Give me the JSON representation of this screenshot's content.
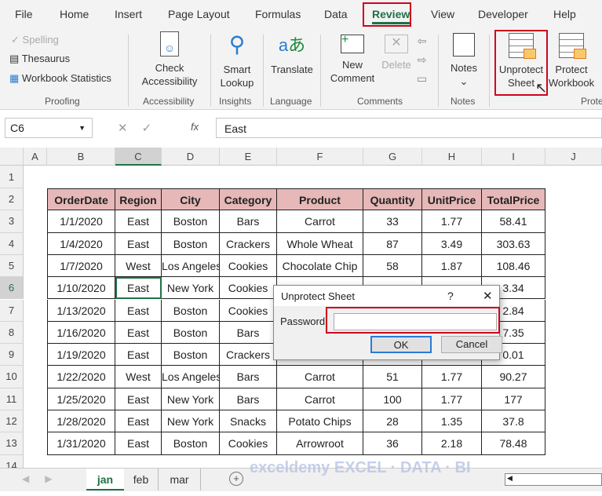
{
  "menu_tabs": [
    "File",
    "Home",
    "Insert",
    "Page Layout",
    "Formulas",
    "Data",
    "Review",
    "View",
    "Developer",
    "Help"
  ],
  "active_tab": "Review",
  "ribbon": {
    "spelling": "Spelling",
    "thesaurus": "Thesaurus",
    "workbook_statistics": "Workbook Statistics",
    "check_accessibility": [
      "Check",
      "Accessibility"
    ],
    "smart_lookup": [
      "Smart",
      "Lookup"
    ],
    "translate": "Translate",
    "new_comment": [
      "New",
      "Comment"
    ],
    "delete": "Delete",
    "notes": "Notes",
    "unprotect_sheet": [
      "Unprotect",
      "Sheet"
    ],
    "protect_workbook": [
      "Protect",
      "Workbook"
    ],
    "groups": [
      "Proofing",
      "Accessibility",
      "Insights",
      "Language",
      "Comments",
      "Notes",
      "Prote"
    ]
  },
  "formula_bar": {
    "name_box": "C6",
    "fx": "fx",
    "value": "East"
  },
  "columns": [
    "A",
    "B",
    "C",
    "D",
    "E",
    "F",
    "G",
    "H",
    "I",
    "J"
  ],
  "rows": [
    "1",
    "2",
    "3",
    "4",
    "5",
    "6",
    "7",
    "8",
    "9",
    "10",
    "11",
    "12",
    "13",
    "14"
  ],
  "table": {
    "headers": [
      "OrderDate",
      "Region",
      "City",
      "Category",
      "Product",
      "Quantity",
      "UnitPrice",
      "TotalPrice"
    ],
    "rows": [
      [
        "1/1/2020",
        "East",
        "Boston",
        "Bars",
        "Carrot",
        "33",
        "1.77",
        "58.41"
      ],
      [
        "1/4/2020",
        "East",
        "Boston",
        "Crackers",
        "Whole Wheat",
        "87",
        "3.49",
        "303.63"
      ],
      [
        "1/7/2020",
        "West",
        "Los Angeles",
        "Cookies",
        "Chocolate Chip",
        "58",
        "1.87",
        "108.46"
      ],
      [
        "1/10/2020",
        "East",
        "New York",
        "Cookies",
        "",
        "",
        "",
        "3.34"
      ],
      [
        "1/13/2020",
        "East",
        "Boston",
        "Cookies",
        "",
        "",
        "",
        "2.84"
      ],
      [
        "1/16/2020",
        "East",
        "Boston",
        "Bars",
        "",
        "",
        "",
        "7.35"
      ],
      [
        "1/19/2020",
        "East",
        "Boston",
        "Crackers",
        "",
        "",
        "",
        "0.01"
      ],
      [
        "1/22/2020",
        "West",
        "Los Angeles",
        "Bars",
        "Carrot",
        "51",
        "1.77",
        "90.27"
      ],
      [
        "1/25/2020",
        "East",
        "New York",
        "Bars",
        "Carrot",
        "100",
        "1.77",
        "177"
      ],
      [
        "1/28/2020",
        "East",
        "New York",
        "Snacks",
        "Potato Chips",
        "28",
        "1.35",
        "37.8"
      ],
      [
        "1/31/2020",
        "East",
        "Boston",
        "Cookies",
        "Arrowroot",
        "36",
        "2.18",
        "78.48"
      ]
    ]
  },
  "dialog": {
    "title": "Unprotect Sheet",
    "help": "?",
    "close": "✕",
    "password_label": "Password:",
    "password_value": "",
    "ok": "OK",
    "cancel": "Cancel"
  },
  "sheets": [
    "jan",
    "feb",
    "mar"
  ],
  "active_sheet": "jan",
  "watermark": "exceldemy EXCEL · DATA · BI"
}
